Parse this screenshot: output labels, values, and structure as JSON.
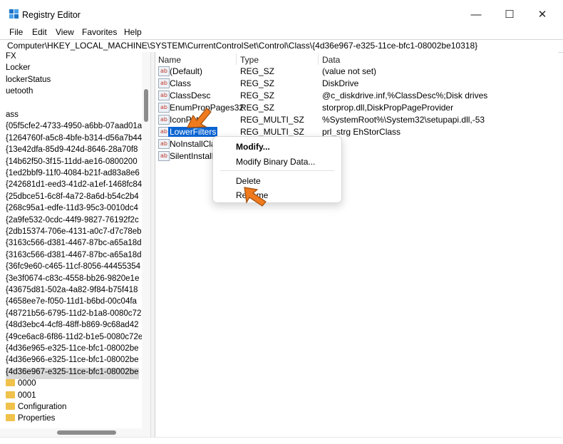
{
  "window": {
    "title": "Registry Editor",
    "min_glyph": "—",
    "max_glyph": "☐",
    "close_glyph": "✕"
  },
  "menu": [
    "File",
    "Edit",
    "View",
    "Favorites",
    "Help"
  ],
  "address": "Computer\\HKEY_LOCAL_MACHINE\\SYSTEM\\CurrentControlSet\\Control\\Class\\{4d36e967-e325-11ce-bfc1-08002be10318}",
  "tree": {
    "items": [
      {
        "label": "FX",
        "folder": false
      },
      {
        "label": "Locker",
        "folder": false
      },
      {
        "label": "lockerStatus",
        "folder": false
      },
      {
        "label": "uetooth",
        "folder": false
      },
      {
        "label": "",
        "folder": false
      },
      {
        "label": "ass",
        "folder": false
      },
      {
        "label": "{05f5cfe2-4733-4950-a6bb-07aad01a",
        "folder": false
      },
      {
        "label": "{1264760f-a5c8-4bfe-b314-d56a7b44",
        "folder": false
      },
      {
        "label": "{13e42dfa-85d9-424d-8646-28a70f8",
        "folder": false
      },
      {
        "label": "{14b62f50-3f15-11dd-ae16-0800200",
        "folder": false
      },
      {
        "label": "{1ed2bbf9-11f0-4084-b21f-ad83a8e6",
        "folder": false
      },
      {
        "label": "{242681d1-eed3-41d2-a1ef-1468fc84",
        "folder": false
      },
      {
        "label": "{25dbce51-6c8f-4a72-8a6d-b54c2b4",
        "folder": false
      },
      {
        "label": "{268c95a1-edfe-11d3-95c3-0010dc4",
        "folder": false
      },
      {
        "label": "{2a9fe532-0cdc-44f9-9827-76192f2c",
        "folder": false
      },
      {
        "label": "{2db15374-706e-4131-a0c7-d7c78eb",
        "folder": false
      },
      {
        "label": "{3163c566-d381-4467-87bc-a65a18d",
        "folder": false
      },
      {
        "label": "{3163c566-d381-4467-87bc-a65a18d",
        "folder": false
      },
      {
        "label": "{36fc9e60-c465-11cf-8056-44455354",
        "folder": false
      },
      {
        "label": "{3e3f0674-c83c-4558-bb26-9820e1e",
        "folder": false
      },
      {
        "label": "{43675d81-502a-4a82-9f84-b75f418",
        "folder": false
      },
      {
        "label": "{4658ee7e-f050-11d1-b6bd-00c04fa",
        "folder": false
      },
      {
        "label": "{48721b56-6795-11d2-b1a8-0080c72",
        "folder": false
      },
      {
        "label": "{48d3ebc4-4cf8-48ff-b869-9c68ad42",
        "folder": false
      },
      {
        "label": "{49ce6ac8-6f86-11d2-b1e5-0080c72e",
        "folder": false
      },
      {
        "label": "{4d36e965-e325-11ce-bfc1-08002be",
        "folder": false
      },
      {
        "label": "{4d36e966-e325-11ce-bfc1-08002be",
        "folder": false
      },
      {
        "label": "{4d36e967-e325-11ce-bfc1-08002be",
        "folder": false,
        "selected": true
      },
      {
        "label": "0000",
        "folder": true
      },
      {
        "label": "0001",
        "folder": true
      },
      {
        "label": "Configuration",
        "folder": true
      },
      {
        "label": "Properties",
        "folder": true
      }
    ]
  },
  "columns": {
    "name": "Name",
    "type": "Type",
    "data": "Data"
  },
  "values": [
    {
      "name": "(Default)",
      "type": "REG_SZ",
      "data": "(value not set)"
    },
    {
      "name": "Class",
      "type": "REG_SZ",
      "data": "DiskDrive"
    },
    {
      "name": "ClassDesc",
      "type": "REG_SZ",
      "data": "@c_diskdrive.inf,%ClassDesc%;Disk drives"
    },
    {
      "name": "EnumPropPages32",
      "type": "REG_SZ",
      "data": "storprop.dll,DiskPropPageProvider"
    },
    {
      "name": "IconPath",
      "type": "REG_MULTI_SZ",
      "data": "%SystemRoot%\\System32\\setupapi.dll,-53"
    },
    {
      "name": "LowerFilters",
      "type": "REG_MULTI_SZ",
      "data": "prl_strg EhStorClass",
      "selected": true
    },
    {
      "name": "NoInstallClass",
      "type": "",
      "data": ""
    },
    {
      "name": "SilentInstall",
      "type": "",
      "data": ""
    }
  ],
  "context_menu": {
    "items": [
      "Modify...",
      "Modify Binary Data...",
      "Delete",
      "Rename"
    ]
  },
  "value_icon_glyph": "ab"
}
